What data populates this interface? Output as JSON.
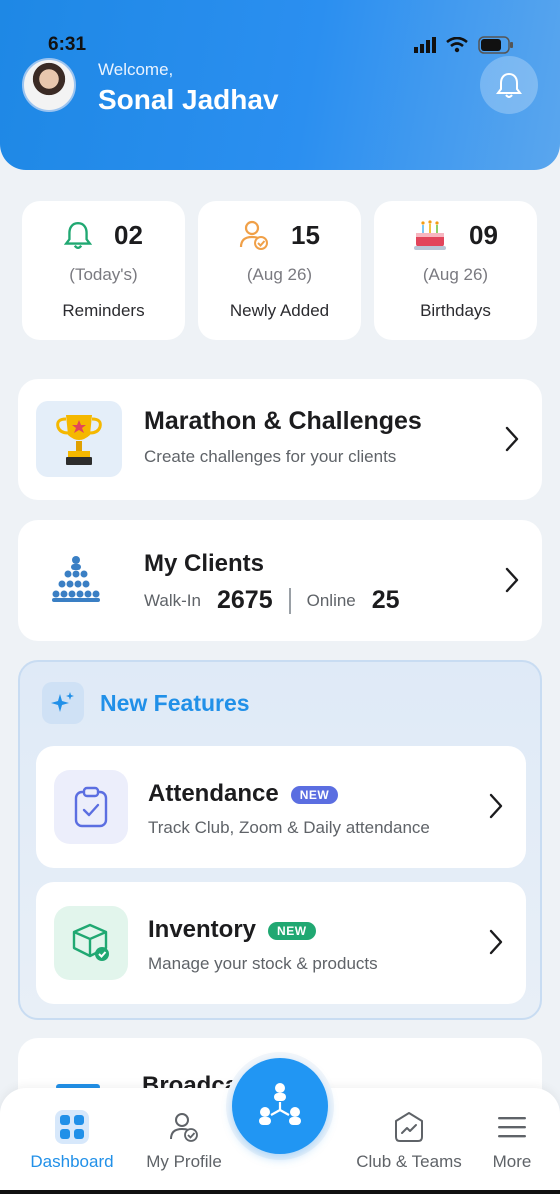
{
  "status_bar": {
    "time": "6:31"
  },
  "header": {
    "welcome": "Welcome,",
    "user_name": "Sonal Jadhav"
  },
  "stats": [
    {
      "count": "02",
      "date": "(Today's)",
      "label": "Reminders",
      "icon": "bell-icon"
    },
    {
      "count": "15",
      "date": "(Aug 26)",
      "label": "Newly Added",
      "icon": "user-check-icon"
    },
    {
      "count": "09",
      "date": "(Aug 26)",
      "label": "Birthdays",
      "icon": "cake-icon"
    }
  ],
  "marathon": {
    "title": "Marathon & Challenges",
    "subtitle": "Create challenges for your clients",
    "icon": "trophy-icon"
  },
  "clients": {
    "title": "My Clients",
    "walkin_label": "Walk-In",
    "walkin_count": "2675",
    "online_label": "Online",
    "online_count": "25",
    "icon": "group-icon"
  },
  "new_features": {
    "title": "New Features",
    "items": [
      {
        "title": "Attendance",
        "badge": "NEW",
        "subtitle": "Track Club, Zoom & Daily attendance",
        "icon": "clipboard-check-icon",
        "badge_color": "#5b6ee1"
      },
      {
        "title": "Inventory",
        "badge": "NEW",
        "subtitle": "Manage your stock & products",
        "icon": "box-check-icon",
        "badge_color": "#20a872"
      }
    ]
  },
  "partial_card": {
    "title": "Broadcasts"
  },
  "bottom_nav": {
    "items": [
      {
        "label": "Dashboard",
        "icon": "grid-icon",
        "active": true
      },
      {
        "label": "My Profile",
        "icon": "profile-icon"
      },
      {
        "label": "Club & Teams",
        "icon": "chart-icon"
      },
      {
        "label": "More",
        "icon": "menu-icon"
      }
    ],
    "fab_icon": "network-icon"
  },
  "colors": {
    "accent": "#2196f3",
    "header_gradient_start": "#1e88e5",
    "background": "#eef2f6",
    "bell_green": "#20a872",
    "profile_orange": "#f0a048"
  }
}
